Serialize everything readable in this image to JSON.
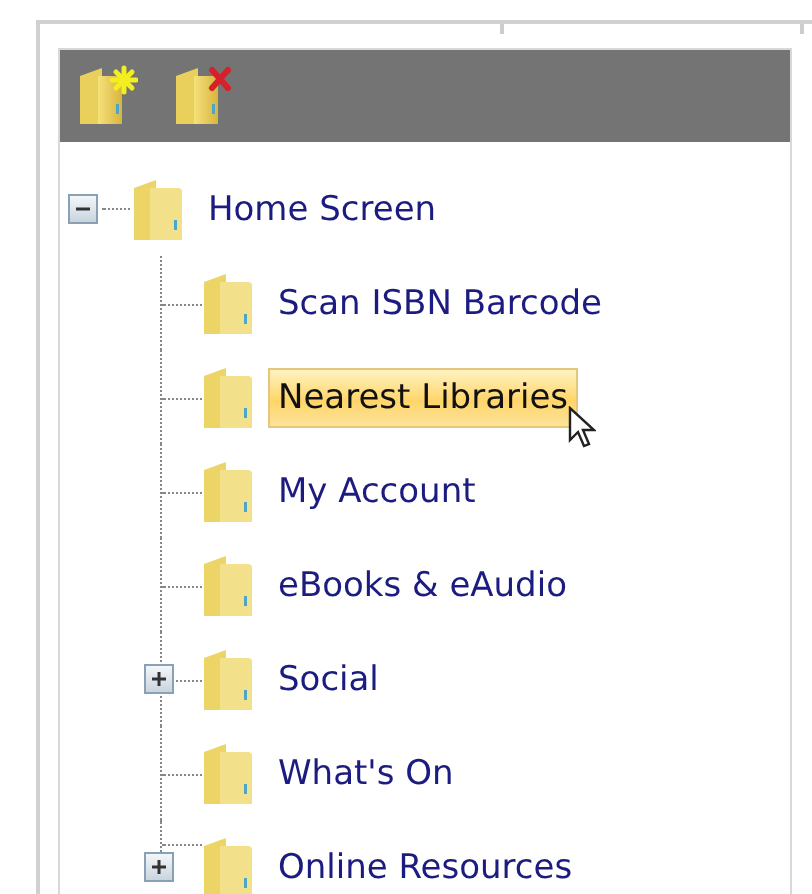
{
  "toolbar": [
    {
      "kind": "add"
    },
    {
      "kind": "delete"
    }
  ],
  "tree": {
    "label": "Home Screen",
    "kind": "branch",
    "expanded": true,
    "selected": false,
    "children": [
      {
        "label": "Scan ISBN Barcode",
        "kind": "leaf",
        "selected": false
      },
      {
        "label": "Nearest Libraries",
        "kind": "leaf",
        "selected": true
      },
      {
        "label": "My Account",
        "kind": "leaf",
        "selected": false
      },
      {
        "label": "eBooks & eAudio",
        "kind": "leaf",
        "selected": false
      },
      {
        "label": "Social",
        "kind": "branch",
        "expanded": false,
        "selected": false
      },
      {
        "label": "What's On",
        "kind": "leaf",
        "selected": false
      },
      {
        "label": "Online Resources",
        "kind": "branch",
        "expanded": false,
        "selected": false
      }
    ]
  }
}
